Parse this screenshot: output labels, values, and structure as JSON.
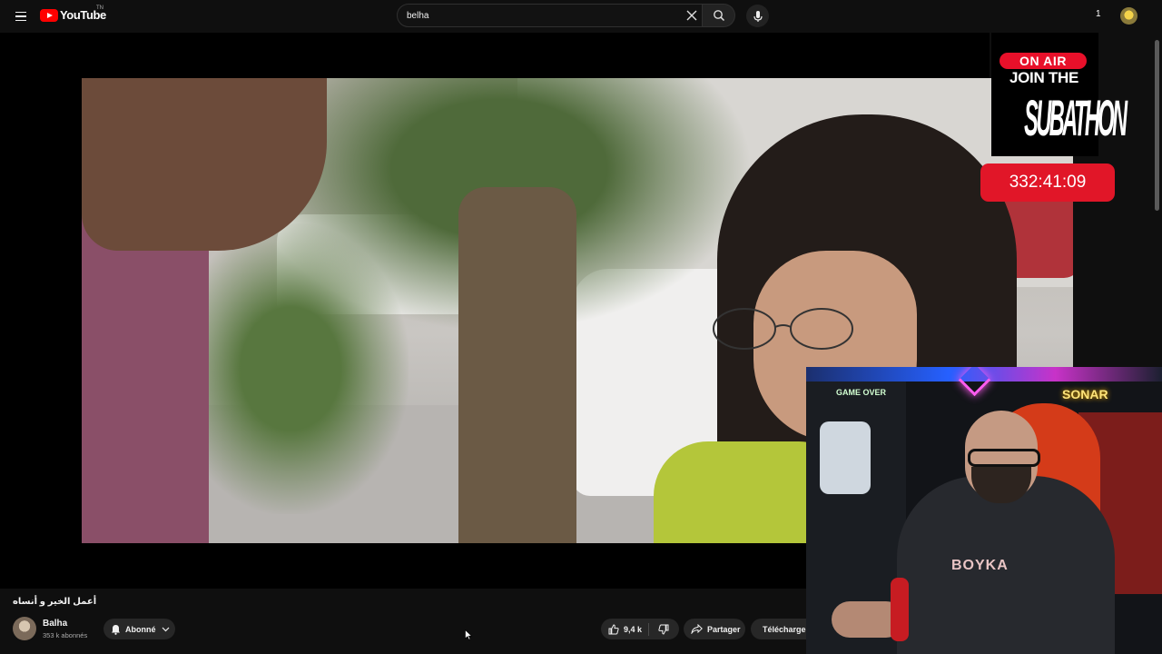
{
  "header": {
    "logo_text": "YouTube",
    "logo_country": "TN",
    "search_value": "belha",
    "notification_count": "1"
  },
  "video": {
    "title": "أعمل الخير و أنساه"
  },
  "channel": {
    "name": "Balha",
    "subscribers": "353 k abonnés",
    "subscribed_label": "Abonné"
  },
  "actions": {
    "like_count": "9,4 k",
    "share_label": "Partager",
    "download_label": "Télécharger"
  },
  "overlay": {
    "on_air": "ON AIR",
    "join_the": "JOIN THE",
    "subathon": "SUBATHON",
    "timer": "332:41:09"
  },
  "webcam": {
    "game_over_text": "GAME OVER",
    "neon_sign": "SONAR",
    "shirt_logo": "BOYKA"
  },
  "colors": {
    "youtube_red": "#ff0000",
    "overlay_red": "#e11628",
    "background": "#0f0f0f",
    "button_bg": "#272727"
  }
}
